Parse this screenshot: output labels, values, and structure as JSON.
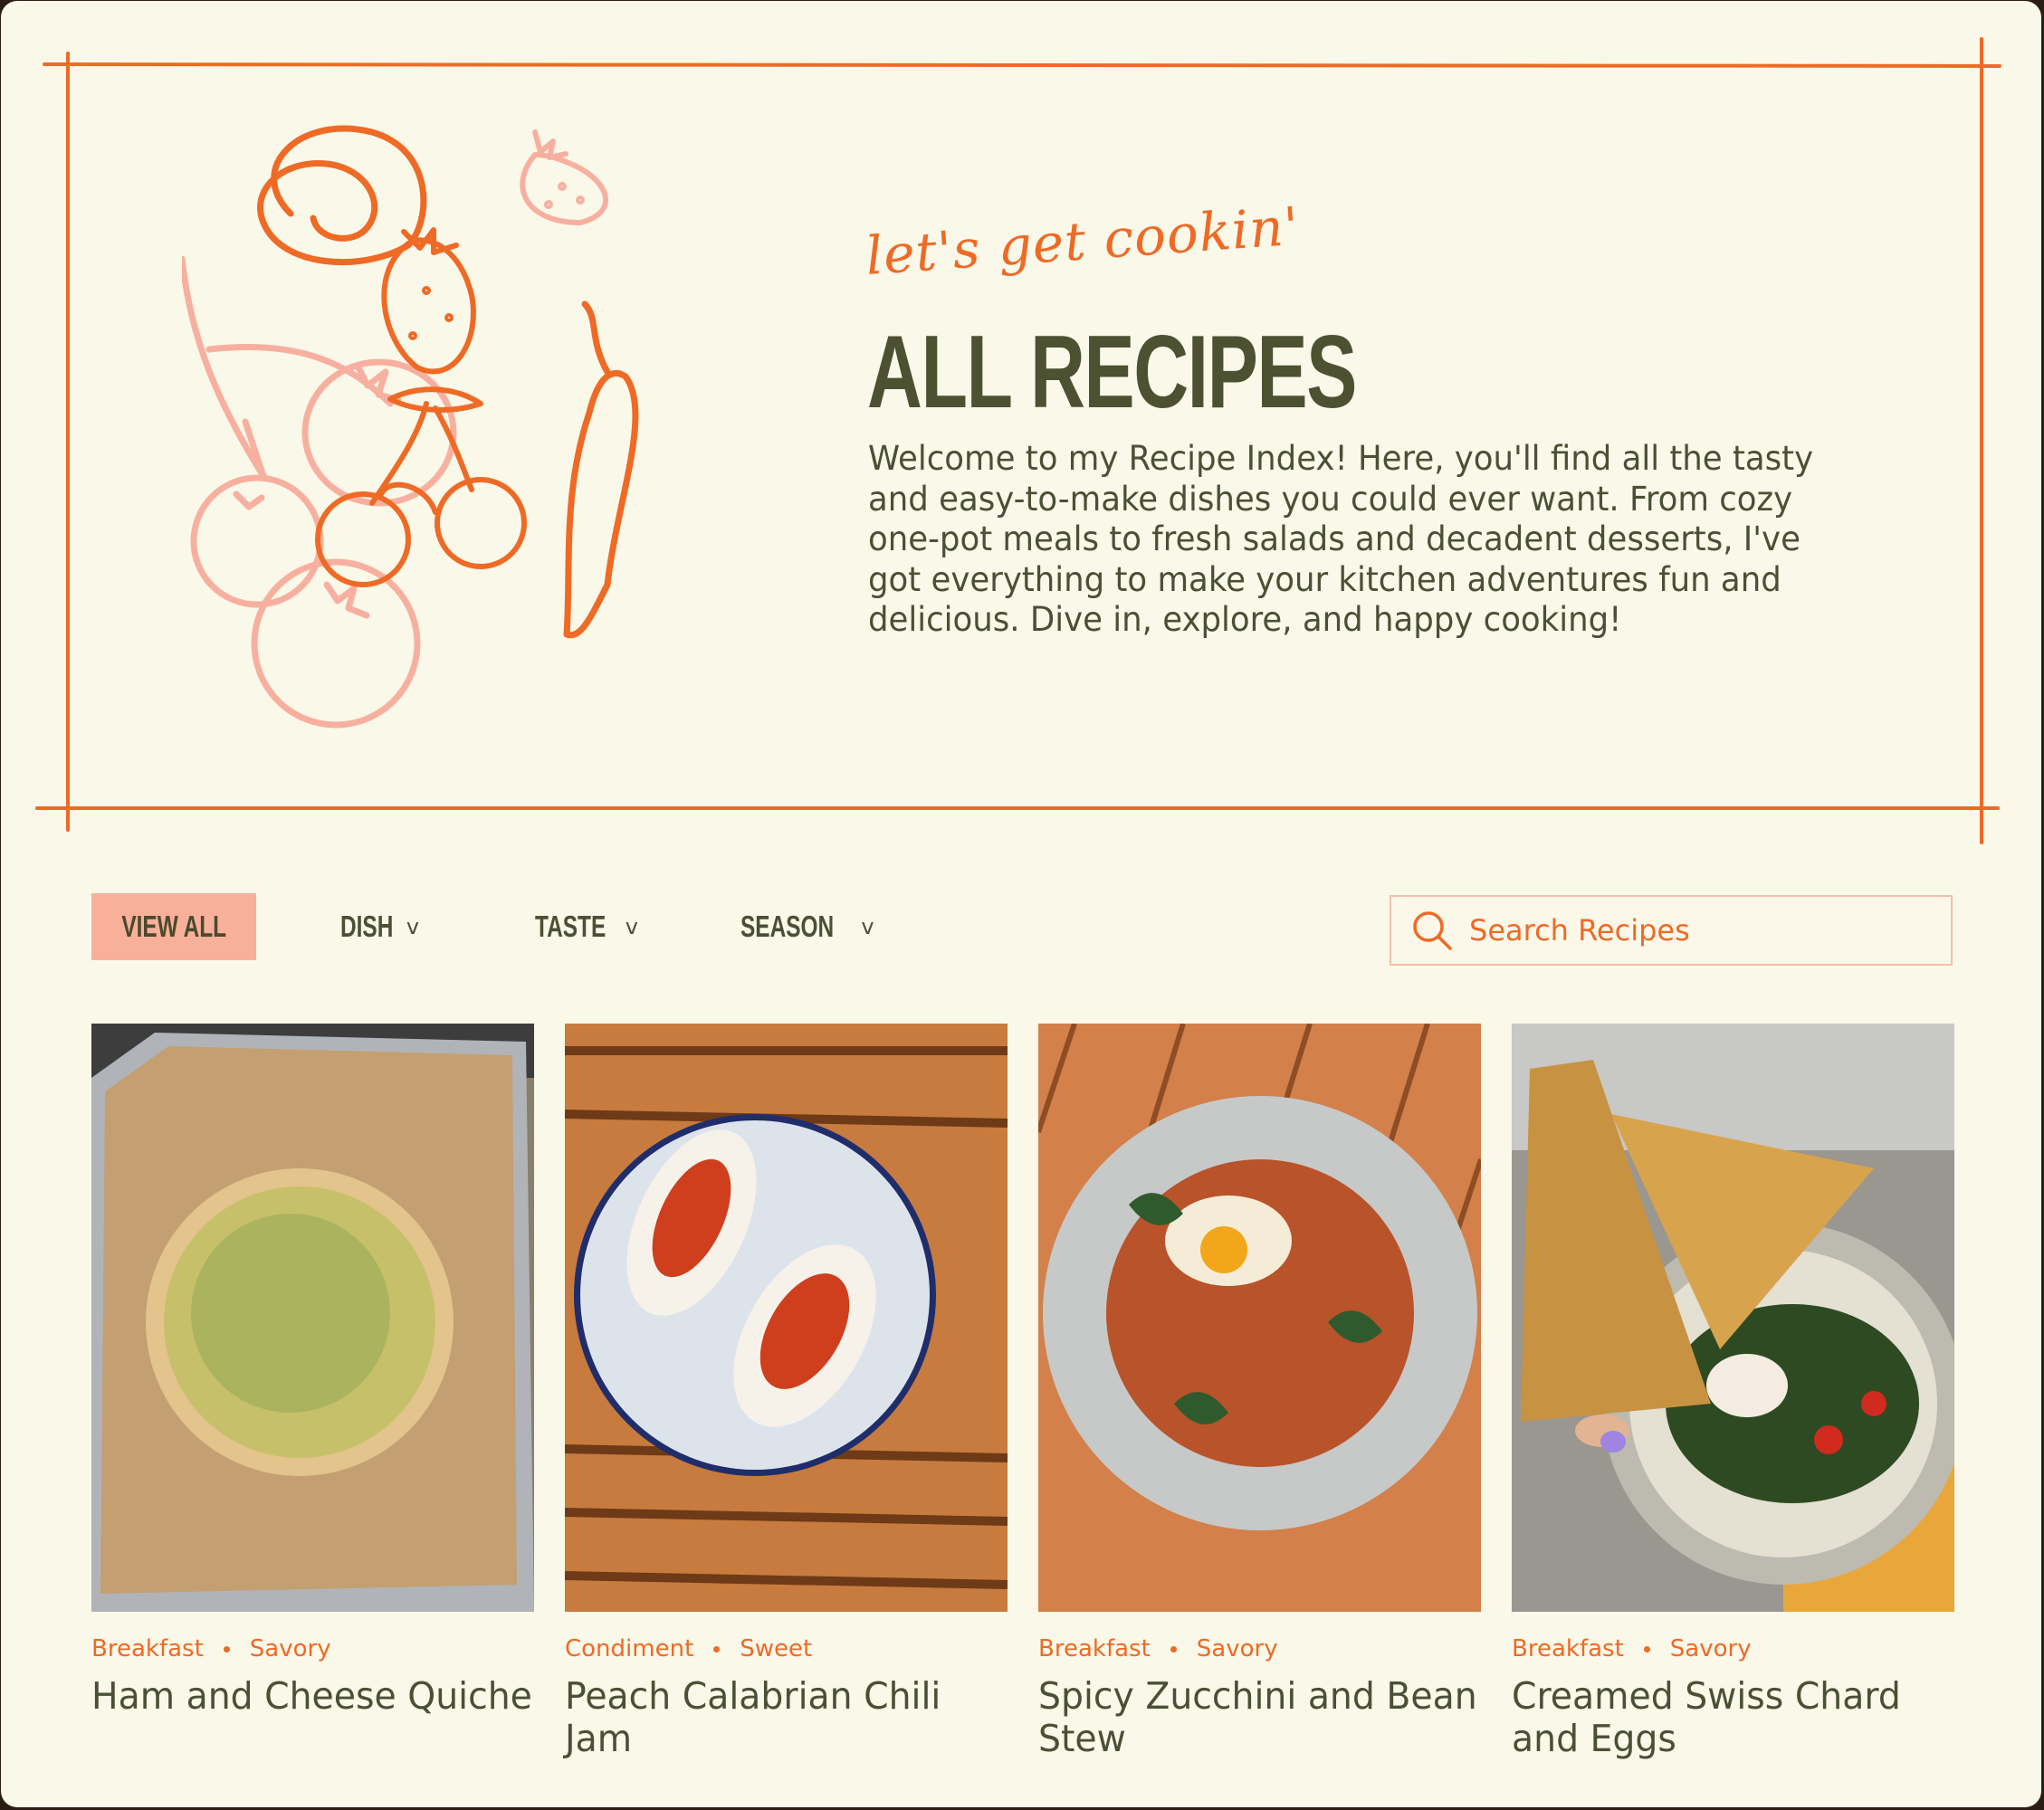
{
  "hero": {
    "tagline": "let's get cookin'",
    "title": "ALL RECIPES",
    "intro": "Welcome to my Recipe Index! Here, you'll find all the tasty and easy-to-make dishes you could ever want. From cozy one-pot meals to fresh salads and decadent desserts, I've got everything to make your kitchen adventures fun and delicious. Dive in, explore, and happy cooking!",
    "illustration": "fruit-and-vegetable-doodles"
  },
  "filters": {
    "view_all": "VIEW ALL",
    "dish": "DISH",
    "taste": "TASTE",
    "season": "SEASON",
    "chevron": "v"
  },
  "search": {
    "placeholder": "Search Recipes",
    "icon": "search-icon"
  },
  "recipes": [
    {
      "tag1": "Breakfast",
      "tag2": "Savory",
      "name": "Ham and Cheese Quiche",
      "photo": "quiche-on-baking-sheet"
    },
    {
      "tag1": "Condiment",
      "tag2": "Sweet",
      "name": "Peach Calabrian Chili Jam",
      "photo": "jam-toast-on-plate"
    },
    {
      "tag1": "Breakfast",
      "tag2": "Savory",
      "name": "Spicy Zucchini and Bean Stew",
      "photo": "bean-stew-bowl"
    },
    {
      "tag1": "Breakfast",
      "tag2": "Savory",
      "name": "Creamed Swiss Chard and Eggs",
      "photo": "chard-eggs-with-toast"
    }
  ],
  "colors": {
    "background": "#faf8e9",
    "accent": "#ee6a25",
    "accent_light": "#f9b09b",
    "text": "#4a5035"
  }
}
